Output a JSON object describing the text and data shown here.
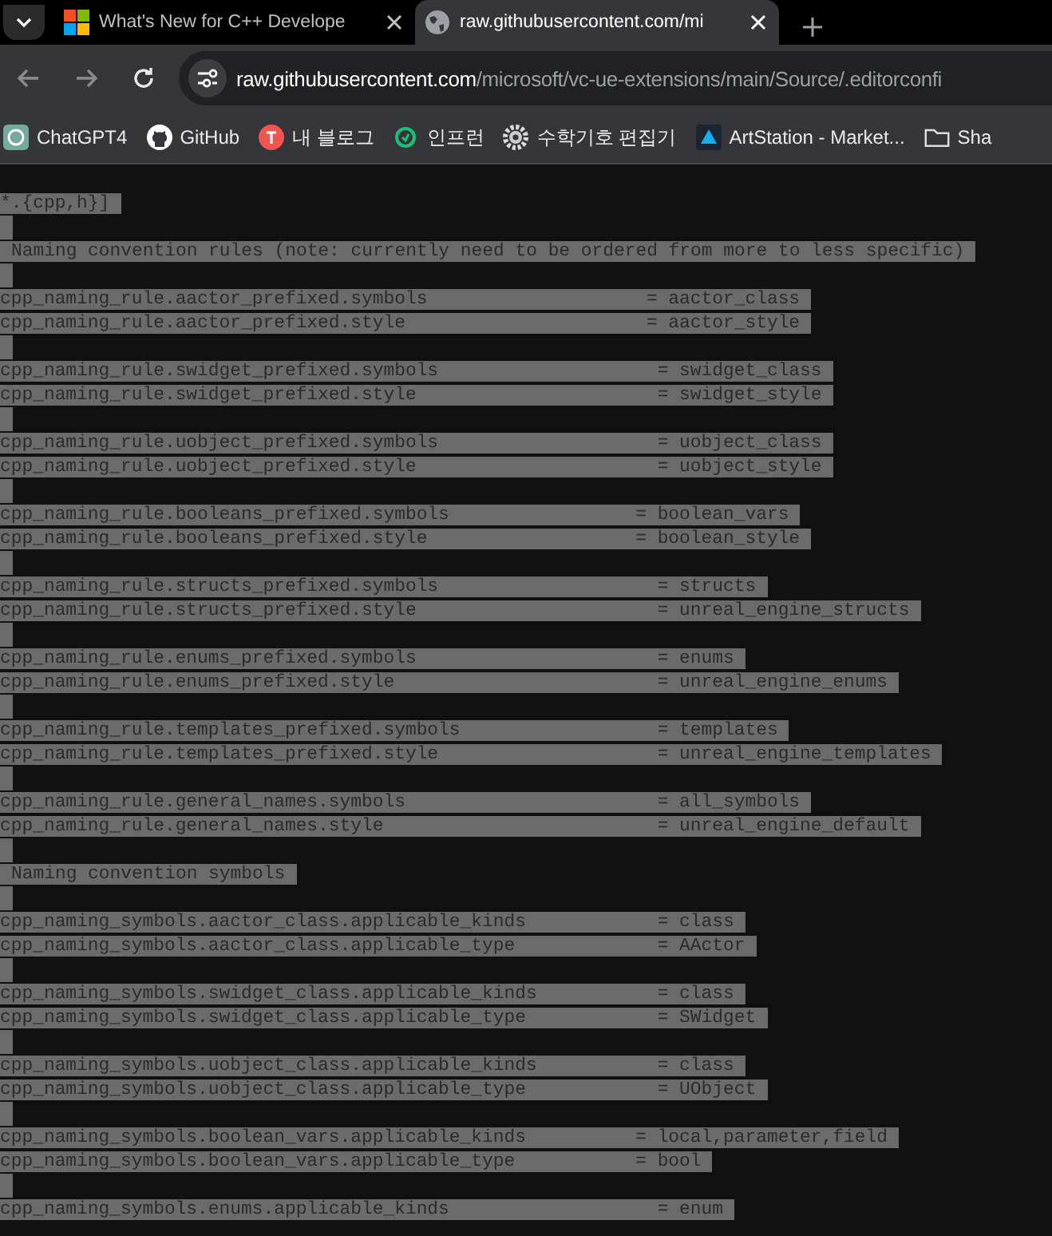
{
  "tabs": [
    {
      "kind": "microsoft",
      "title": "What's New for C++ Develope",
      "selected": false
    },
    {
      "kind": "globe",
      "title": "raw.githubusercontent.com/mi",
      "selected": true
    }
  ],
  "address_bar": {
    "host": "raw.githubusercontent.com",
    "path": "/microsoft/vc-ue-extensions/main/Source/.editorconfi"
  },
  "bookmarks": [
    {
      "kind": "chatgpt",
      "label": "ChatGPT4"
    },
    {
      "kind": "github",
      "label": "GitHub"
    },
    {
      "kind": "blog",
      "label": "내 블로그"
    },
    {
      "kind": "inflearn",
      "label": "인프런"
    },
    {
      "kind": "gear",
      "label": "수학기호 편집기"
    },
    {
      "kind": "artstation",
      "label": "ArtStation - Market..."
    },
    {
      "kind": "folder",
      "label": "Sha"
    }
  ],
  "content": {
    "selected": true,
    "lines": [
      {
        "kind": "header",
        "text": "*.{cpp,h}]"
      },
      {
        "kind": "blank"
      },
      {
        "kind": "comment",
        "text": "Naming convention rules (note: currently need to be ordered from more to less specific)"
      },
      {
        "kind": "blank"
      },
      {
        "kind": "rule",
        "text": "cpp_naming_rule.aactor_prefixed.symbols                    = aactor_class"
      },
      {
        "kind": "rule",
        "text": "cpp_naming_rule.aactor_prefixed.style                      = aactor_style"
      },
      {
        "kind": "blank"
      },
      {
        "kind": "rule",
        "text": "cpp_naming_rule.swidget_prefixed.symbols                    = swidget_class"
      },
      {
        "kind": "rule",
        "text": "cpp_naming_rule.swidget_prefixed.style                      = swidget_style"
      },
      {
        "kind": "blank"
      },
      {
        "kind": "rule",
        "text": "cpp_naming_rule.uobject_prefixed.symbols                    = uobject_class"
      },
      {
        "kind": "rule",
        "text": "cpp_naming_rule.uobject_prefixed.style                      = uobject_style"
      },
      {
        "kind": "blank"
      },
      {
        "kind": "rule",
        "text": "cpp_naming_rule.booleans_prefixed.symbols                 = boolean_vars"
      },
      {
        "kind": "rule",
        "text": "cpp_naming_rule.booleans_prefixed.style                   = boolean_style"
      },
      {
        "kind": "blank"
      },
      {
        "kind": "rule",
        "text": "cpp_naming_rule.structs_prefixed.symbols                    = structs"
      },
      {
        "kind": "rule",
        "text": "cpp_naming_rule.structs_prefixed.style                      = unreal_engine_structs"
      },
      {
        "kind": "blank"
      },
      {
        "kind": "rule",
        "text": "cpp_naming_rule.enums_prefixed.symbols                      = enums"
      },
      {
        "kind": "rule",
        "text": "cpp_naming_rule.enums_prefixed.style                        = unreal_engine_enums"
      },
      {
        "kind": "blank"
      },
      {
        "kind": "rule",
        "text": "cpp_naming_rule.templates_prefixed.symbols                  = templates"
      },
      {
        "kind": "rule",
        "text": "cpp_naming_rule.templates_prefixed.style                    = unreal_engine_templates"
      },
      {
        "kind": "blank"
      },
      {
        "kind": "rule",
        "text": "cpp_naming_rule.general_names.symbols                       = all_symbols"
      },
      {
        "kind": "rule",
        "text": "cpp_naming_rule.general_names.style                         = unreal_engine_default"
      },
      {
        "kind": "blank"
      },
      {
        "kind": "comment",
        "text": "Naming convention symbols"
      },
      {
        "kind": "blank"
      },
      {
        "kind": "rule",
        "text": "cpp_naming_symbols.aactor_class.applicable_kinds            = class"
      },
      {
        "kind": "rule",
        "text": "cpp_naming_symbols.aactor_class.applicable_type             = AActor"
      },
      {
        "kind": "blank"
      },
      {
        "kind": "rule",
        "text": "cpp_naming_symbols.swidget_class.applicable_kinds           = class"
      },
      {
        "kind": "rule",
        "text": "cpp_naming_symbols.swidget_class.applicable_type            = SWidget"
      },
      {
        "kind": "blank"
      },
      {
        "kind": "rule",
        "text": "cpp_naming_symbols.uobject_class.applicable_kinds           = class"
      },
      {
        "kind": "rule",
        "text": "cpp_naming_symbols.uobject_class.applicable_type            = UObject"
      },
      {
        "kind": "blank"
      },
      {
        "kind": "rule",
        "text": "cpp_naming_symbols.boolean_vars.applicable_kinds          = local,parameter,field"
      },
      {
        "kind": "rule",
        "text": "cpp_naming_symbols.boolean_vars.applicable_type           = bool"
      },
      {
        "kind": "blank"
      },
      {
        "kind": "rule",
        "text": "cpp_naming_symbols.enums.applicable_kinds                   = enum"
      }
    ]
  }
}
